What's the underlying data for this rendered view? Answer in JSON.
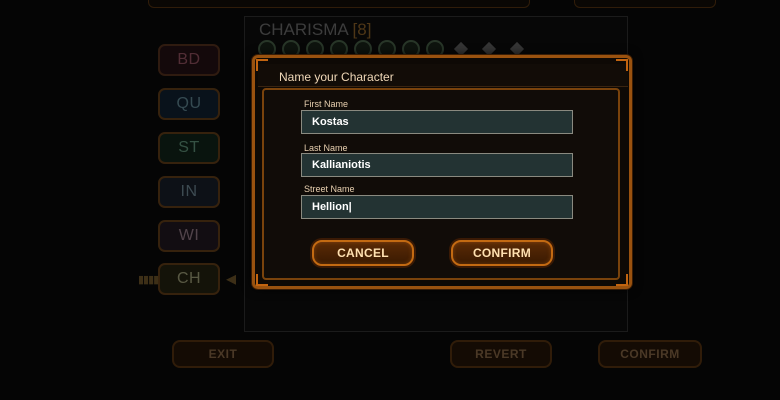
{
  "background": {
    "attributes": [
      "BD",
      "QU",
      "ST",
      "IN",
      "WI",
      "CH"
    ],
    "selected_attribute": "CH",
    "stat_heading": "CHARISMA",
    "stat_value": "[8]",
    "bottom_buttons": {
      "exit_label": "EXIT",
      "revert_label": "REVERT",
      "confirm_label": "CONFIRM"
    }
  },
  "dialog": {
    "title": "Name your Character",
    "fields": {
      "first_name_label": "First Name",
      "first_name_value": "Kostas",
      "last_name_label": "Last Name",
      "last_name_value": "Kallianiotis",
      "street_name_label": "Street Name",
      "street_name_value": "Hellion|"
    },
    "cancel_label": "CANCEL",
    "confirm_label": "CONFIRM"
  },
  "colors": {
    "accent_orange": "#c36a12",
    "frame_dark": "#9a520f",
    "input_bg": "#233333"
  }
}
